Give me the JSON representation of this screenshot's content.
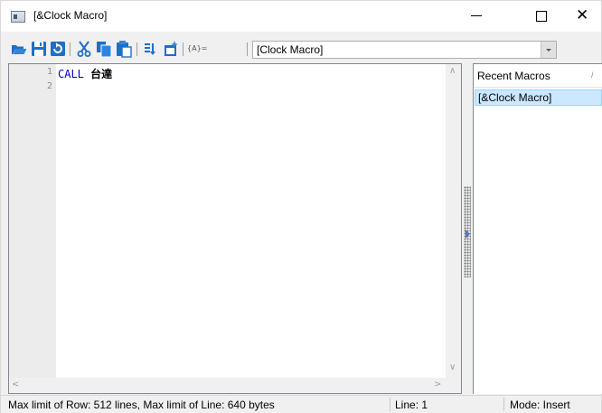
{
  "window": {
    "title": "[&Clock Macro]",
    "controls": {
      "minimize": "—",
      "maximize": "☐",
      "close": "✕"
    }
  },
  "toolbar": {
    "icons": [
      "open-folder-icon",
      "save-icon",
      "refresh-icon",
      "cut-icon",
      "copy-icon",
      "paste-icon",
      "list-icon",
      "new-window-icon",
      "insert-arg-icon"
    ],
    "insert_arg_label": "{A}=",
    "macro_select": {
      "value": "[Clock Macro]"
    }
  },
  "editor": {
    "line_numbers": [
      "1",
      "2"
    ],
    "line1": {
      "keyword": "CALL",
      "argument": "台達"
    }
  },
  "recent_panel": {
    "header": "Recent Macros",
    "items": [
      "[&Clock Macro]"
    ]
  },
  "status_bar": {
    "limits": "Max limit of Row: 512 lines, Max limit of Line: 640 bytes",
    "line": "Line: 1",
    "mode": "Mode: Insert"
  },
  "colors": {
    "keyword": "#0000c8",
    "selection": "#cce8ff",
    "chrome": "#f0f0f0"
  }
}
